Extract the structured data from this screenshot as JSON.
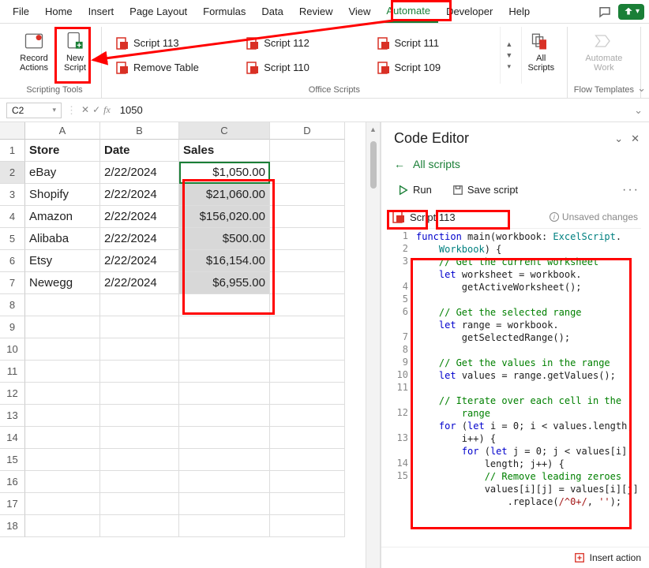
{
  "menu": [
    "File",
    "Home",
    "Insert",
    "Page Layout",
    "Formulas",
    "Data",
    "Review",
    "View",
    "Automate",
    "Developer",
    "Help"
  ],
  "active_menu_index": 8,
  "ribbon": {
    "scripting_tools": {
      "record": "Record Actions",
      "new": "New Script",
      "label": "Scripting Tools"
    },
    "gallery": [
      "Script 113",
      "Script 112",
      "Script 111",
      "Remove Table",
      "Script 110",
      "Script 109"
    ],
    "gallery_label": "Office Scripts",
    "all_scripts": "All Scripts",
    "automate": "Automate Work",
    "flow_label": "Flow Templates"
  },
  "namebox": "C2",
  "formula": "1050",
  "cols": [
    "A",
    "B",
    "C",
    "D"
  ],
  "headers": [
    "Store",
    "Date",
    "Sales"
  ],
  "rows": [
    {
      "store": "eBay",
      "date": "2/22/2024",
      "sales": "$1,050.00"
    },
    {
      "store": "Shopify",
      "date": "2/22/2024",
      "sales": "$21,060.00"
    },
    {
      "store": "Amazon",
      "date": "2/22/2024",
      "sales": "$156,020.00"
    },
    {
      "store": "Alibaba",
      "date": "2/22/2024",
      "sales": "$500.00"
    },
    {
      "store": "Etsy",
      "date": "2/22/2024",
      "sales": "$16,154.00"
    },
    {
      "store": "Newegg",
      "date": "2/22/2024",
      "sales": "$6,955.00"
    }
  ],
  "panel": {
    "title": "Code Editor",
    "back": "All scripts",
    "run": "Run",
    "save": "Save script",
    "script_name": "Script 113",
    "unsaved": "Unsaved changes",
    "footer": "Insert action"
  },
  "code_lines": [
    1,
    2,
    3,
    "",
    4,
    5,
    6,
    "",
    7,
    8,
    9,
    10,
    11,
    "",
    12,
    "",
    13,
    "",
    14,
    15,
    ""
  ],
  "chart_data": {
    "type": "table",
    "columns": [
      "Store",
      "Date",
      "Sales"
    ],
    "rows": [
      [
        "eBay",
        "2/22/2024",
        1050.0
      ],
      [
        "Shopify",
        "2/22/2024",
        21060.0
      ],
      [
        "Amazon",
        "2/22/2024",
        156020.0
      ],
      [
        "Alibaba",
        "2/22/2024",
        500.0
      ],
      [
        "Etsy",
        "2/22/2024",
        16154.0
      ],
      [
        "Newegg",
        "2/22/2024",
        6955.0
      ]
    ]
  }
}
